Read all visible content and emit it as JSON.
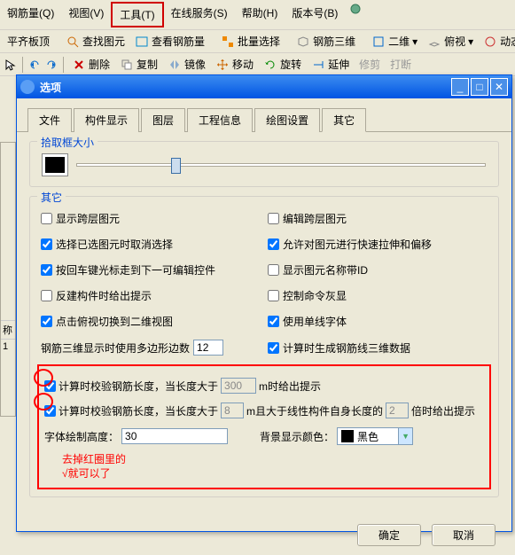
{
  "menubar": {
    "items": [
      {
        "label": "钢筋量(Q)"
      },
      {
        "label": "视图(V)"
      },
      {
        "label": "工具(T)"
      },
      {
        "label": "在线服务(S)"
      },
      {
        "label": "帮助(H)"
      },
      {
        "label": "版本号(B)"
      }
    ]
  },
  "toolbar1": {
    "items": [
      "平齐板顶",
      "查找图元",
      "查看钢筋量",
      "批量选择",
      "钢筋三维",
      "二维",
      "俯视",
      "动态观"
    ]
  },
  "toolbar2": {
    "items": [
      "删除",
      "复制",
      "镜像",
      "移动",
      "旋转",
      "延伸",
      "修剪",
      "打断"
    ]
  },
  "dialog": {
    "title": "选项",
    "tabs": [
      "文件",
      "构件显示",
      "图层",
      "工程信息",
      "绘图设置",
      "其它"
    ],
    "active_tab": 5,
    "group1": {
      "legend": "拾取框大小"
    },
    "group2": {
      "legend": "其它",
      "checks": [
        {
          "label": "显示跨层图元",
          "checked": false
        },
        {
          "label": "编辑跨层图元",
          "checked": false
        },
        {
          "label": "选择已选图元时取消选择",
          "checked": true
        },
        {
          "label": "允许对图元进行快速拉伸和偏移",
          "checked": true
        },
        {
          "label": "按回车键光标走到下一可编辑控件",
          "checked": true
        },
        {
          "label": "显示图元名称带ID",
          "checked": false
        },
        {
          "label": "反建构件时给出提示",
          "checked": false
        },
        {
          "label": "控制命令灰显",
          "checked": false
        },
        {
          "label": "点击俯视切换到二维视图",
          "checked": true
        },
        {
          "label": "使用单线字体",
          "checked": true
        }
      ],
      "polyedges": {
        "label": "钢筋三维显示时使用多边形边数",
        "value": "12"
      },
      "gendata": {
        "label": "计算时生成钢筋线三维数据",
        "checked": true
      }
    },
    "redbox": {
      "row1": {
        "check_label": "计算时校验钢筋长度，当长度大于",
        "checked": true,
        "val": "300",
        "suffix": "m时给出提示"
      },
      "row2": {
        "check_label": "计算时校验钢筋长度，当长度大于",
        "checked": true,
        "val": "8",
        "mid": "m且大于线性构件自身长度的",
        "val2": "2",
        "suffix": "倍时给出提示"
      },
      "row3": {
        "label": "字体绘制高度：",
        "val": "30",
        "label2": "背景显示颜色：",
        "color_name": "黑色"
      },
      "note1": "去掉红圈里的",
      "note2": "√就可以了"
    },
    "ok": "确定",
    "cancel": "取消"
  },
  "side": {
    "l1": "称",
    "l2": "1"
  }
}
